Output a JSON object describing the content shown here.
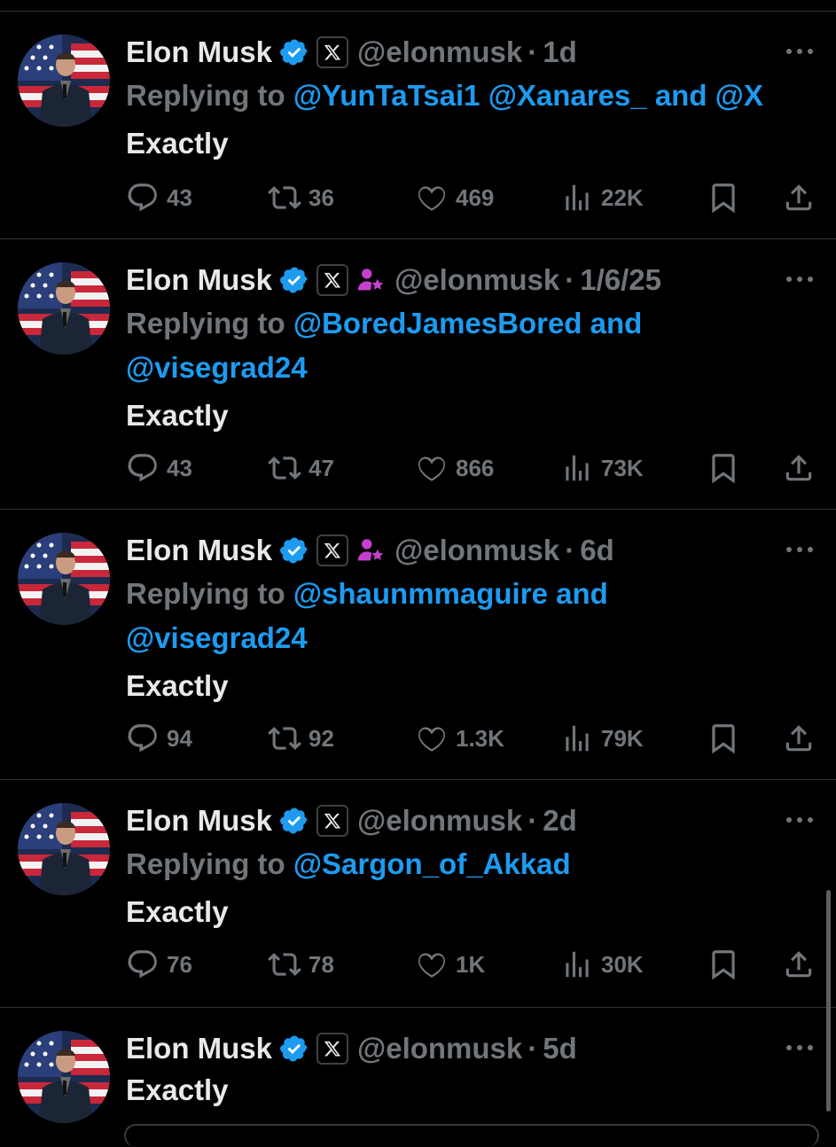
{
  "tweets": [
    {
      "name": "Elon Musk",
      "handle": "@elonmusk",
      "separator": "·",
      "time": "1d",
      "affiliate_badge": false,
      "replying_prefix": "Replying to",
      "replying_line1": "@YunTaTsai1 @Xanares_ and @X",
      "replying_line2": "",
      "text": "Exactly",
      "stats": {
        "replies": "43",
        "retweets": "36",
        "likes": "469",
        "views": "22K"
      }
    },
    {
      "name": "Elon Musk",
      "handle": "@elonmusk",
      "separator": "·",
      "time": "1/6/25",
      "affiliate_badge": true,
      "replying_prefix": "Replying to",
      "replying_line1": "@BoredJamesBored and",
      "replying_line2": "@visegrad24",
      "text": "Exactly",
      "stats": {
        "replies": "43",
        "retweets": "47",
        "likes": "866",
        "views": "73K"
      }
    },
    {
      "name": "Elon Musk",
      "handle": "@elonmusk",
      "separator": "·",
      "time": "6d",
      "affiliate_badge": true,
      "replying_prefix": "Replying to",
      "replying_line1": "@shaunmmaguire and",
      "replying_line2": "@visegrad24",
      "text": "Exactly",
      "stats": {
        "replies": "94",
        "retweets": "92",
        "likes": "1.3K",
        "views": "79K"
      }
    },
    {
      "name": "Elon Musk",
      "handle": "@elonmusk",
      "separator": "·",
      "time": "2d",
      "affiliate_badge": false,
      "replying_prefix": "Replying to",
      "replying_line1": "@Sargon_of_Akkad",
      "replying_line2": "",
      "text": "Exactly",
      "stats": {
        "replies": "76",
        "retweets": "78",
        "likes": "1K",
        "views": "30K"
      }
    },
    {
      "name": "Elon Musk",
      "handle": "@elonmusk",
      "separator": "·",
      "time": "5d",
      "affiliate_badge": false,
      "text": "Exactly"
    }
  ],
  "colors": {
    "background": "#000000",
    "text": "#e7e9ea",
    "muted": "#71767b",
    "mention": "#1d9bf0",
    "verified": "#1d9bf0",
    "affiliate": "#c83fd0",
    "divider": "#2f3336"
  },
  "icons": [
    "verified-badge-icon",
    "x-logo-icon",
    "affiliate-badge-icon",
    "reply-icon",
    "retweet-icon",
    "like-icon",
    "views-icon",
    "bookmark-icon",
    "share-icon",
    "more-icon"
  ]
}
